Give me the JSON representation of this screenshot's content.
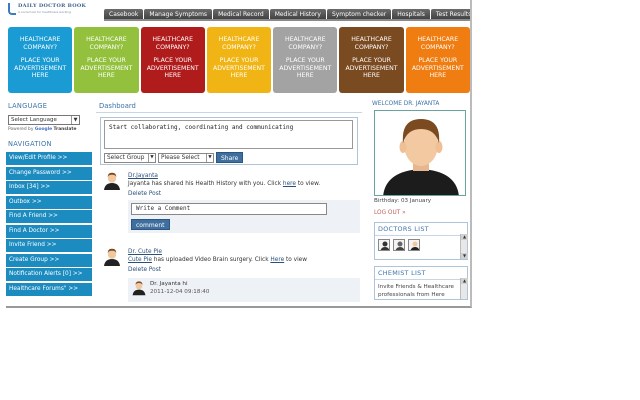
{
  "logo": {
    "brand": "DAILY DOCTOR BOOK",
    "tagline": "A social tool for healthcare working"
  },
  "topnav": [
    "Casebook",
    "Manage Symptoms",
    "Medical Record",
    "Medical History",
    "Symptom checker",
    "Hospitals",
    "Test Results"
  ],
  "ads": [
    {
      "title1": "HEALTHCARE",
      "title2": "COMPANY?",
      "body1": "PLACE YOUR",
      "body2": "ADVERTISEMENT",
      "body3": "HERE",
      "color": "#1a9bd4"
    },
    {
      "title1": "HEALTHCARE",
      "title2": "COMPANY?",
      "body1": "PLACE YOUR",
      "body2": "ADVERTISEMENT",
      "body3": "HERE",
      "color": "#93c13d"
    },
    {
      "title1": "HEALTHCARE",
      "title2": "COMPANY?",
      "body1": "PLACE YOUR",
      "body2": "ADVERTISEMENT",
      "body3": "HERE",
      "color": "#b01c1c"
    },
    {
      "title1": "HEALTHCARE",
      "title2": "COMPANY?",
      "body1": "PLACE YOUR",
      "body2": "ADVERTISEMENT",
      "body3": "HERE",
      "color": "#f0b515"
    },
    {
      "title1": "HEALTHCARE",
      "title2": "COMPANY?",
      "body1": "PLACE YOUR",
      "body2": "ADVERTISEMENT",
      "body3": "HERE",
      "color": "#a3a3a3"
    },
    {
      "title1": "HEALTHCARE",
      "title2": "COMPANY?",
      "body1": "PLACE YOUR",
      "body2": "ADVERTISEMENT",
      "body3": "HERE",
      "color": "#7a4a21"
    },
    {
      "title1": "HEALTHCARE",
      "title2": "COMPANY?",
      "body1": "PLACE YOUR",
      "body2": "ADVERTISEMENT",
      "body3": "HERE",
      "color": "#ef7d12"
    }
  ],
  "sidebar": {
    "language_title": "LANGUAGE",
    "language_select": "Select Language",
    "powered_by": "Powered by",
    "google": "Google",
    "translate": "Translate",
    "nav_title": "NAVIGATION",
    "items": [
      "View/Edit Profile >>",
      "Change Password >>",
      "Inbox [34] >>",
      "Outbox >>",
      "Find A Friend >>",
      "Find A Doctor >>",
      "Invite Friend >>",
      "Create Group >>",
      "Notification Alerts [0] >>",
      "Healthcare Forums\" >>"
    ]
  },
  "dashboard": {
    "title": "Dashboard",
    "compose_text": "Start collaborating, coordinating and communicating",
    "group_select": "Select Group",
    "privacy_select": "Please Select",
    "share_label": "Share",
    "posts": [
      {
        "author": "Dr.Jayanta",
        "msg_pre": "Jayanta has shared his Health History with you. Click ",
        "msg_link": "here",
        "msg_post": " to view.",
        "delete": "Delete Post",
        "comment_placeholder": "Write a Comment",
        "comment_btn": "comment"
      },
      {
        "author": "Dr. Cute Pie",
        "msg_author": "Cute Pie",
        "msg_pre": " has uploaded Video Brain surgery. Click ",
        "msg_link": "Here",
        "msg_post": " to view",
        "delete": "Delete Post",
        "reply_name": "Dr. Jayanta hi",
        "reply_time": "2011-12-04 09:18:40"
      }
    ]
  },
  "right": {
    "welcome": "WELCOME DR. JAYANTA",
    "birthday": "Birthday: 03 January",
    "logout": "LOG OUT »",
    "doctors_title": "DOCTORS LIST",
    "chemist_title": "CHEMIST LIST",
    "chemist_text": "Invite Friends & Healthcare professionals from Here"
  },
  "colors": {
    "nav_blue": "#1c8bbf",
    "title_blue": "#3b73a8",
    "button_blue": "#3f6f9e"
  }
}
